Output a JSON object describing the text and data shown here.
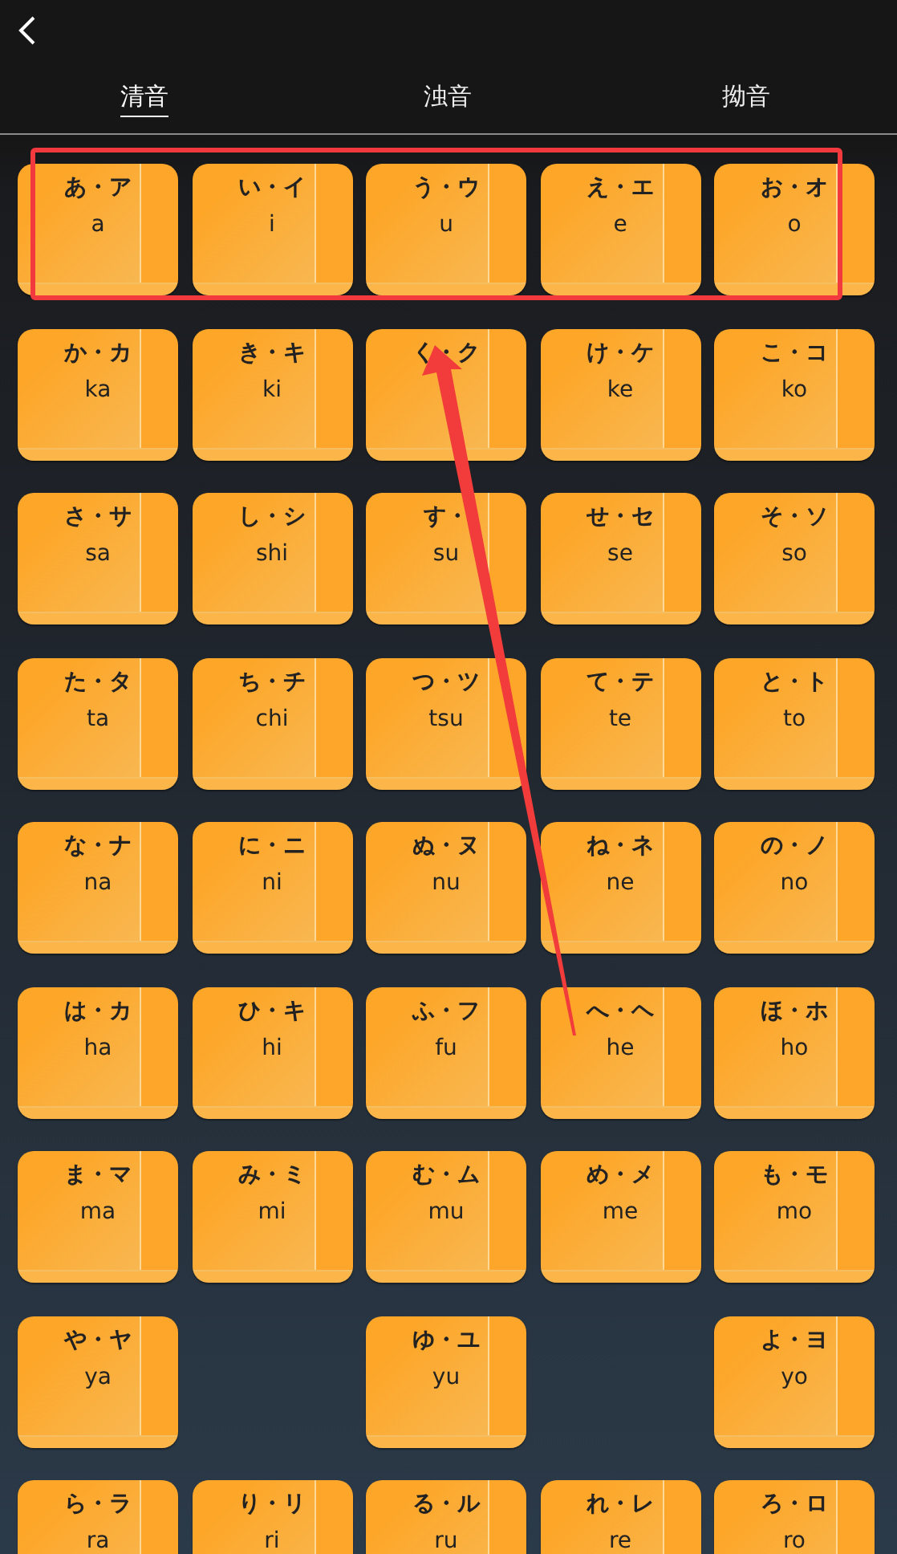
{
  "tabs": [
    {
      "label": "清音",
      "selected": true
    },
    {
      "label": "浊音",
      "selected": false
    },
    {
      "label": "拗音",
      "selected": false
    }
  ],
  "keys": [
    {
      "kind": "key",
      "kana": "あ・ア",
      "romaji": "a"
    },
    {
      "kind": "key",
      "kana": "い・イ",
      "romaji": "i"
    },
    {
      "kind": "key",
      "kana": "う・ウ",
      "romaji": "u"
    },
    {
      "kind": "key",
      "kana": "え・エ",
      "romaji": "e"
    },
    {
      "kind": "key",
      "kana": "お・オ",
      "romaji": "o"
    },
    {
      "kind": "key",
      "kana": "か・カ",
      "romaji": "ka"
    },
    {
      "kind": "key",
      "kana": "き・キ",
      "romaji": "ki"
    },
    {
      "kind": "key",
      "kana": "く・ク"
    },
    {
      "kind": "key",
      "kana": "け・ケ",
      "romaji": "ke"
    },
    {
      "kind": "key",
      "kana": "こ・コ",
      "romaji": "ko"
    },
    {
      "kind": "key",
      "kana": "さ・サ",
      "romaji": "sa"
    },
    {
      "kind": "key",
      "kana": "し・シ",
      "romaji": "shi"
    },
    {
      "kind": "key",
      "kana": "す・",
      "romaji": "su"
    },
    {
      "kind": "key",
      "kana": "せ・セ",
      "romaji": "se"
    },
    {
      "kind": "key",
      "kana": "そ・ソ",
      "romaji": "so"
    },
    {
      "kind": "key",
      "kana": "た・タ",
      "romaji": "ta"
    },
    {
      "kind": "key",
      "kana": "ち・チ",
      "romaji": "chi"
    },
    {
      "kind": "key",
      "kana": "つ・ツ",
      "romaji": "tsu"
    },
    {
      "kind": "key",
      "kana": "て・テ",
      "romaji": "te"
    },
    {
      "kind": "key",
      "kana": "と・ト",
      "romaji": "to"
    },
    {
      "kind": "key",
      "kana": "な・ナ",
      "romaji": "na"
    },
    {
      "kind": "key",
      "kana": "に・ニ",
      "romaji": "ni"
    },
    {
      "kind": "key",
      "kana": "ぬ・ヌ",
      "romaji": "nu"
    },
    {
      "kind": "key",
      "kana": "ね・ネ",
      "romaji": "ne"
    },
    {
      "kind": "key",
      "kana": "の・ノ",
      "romaji": "no"
    },
    {
      "kind": "key",
      "kana": "は・カ",
      "romaji": "ha"
    },
    {
      "kind": "key",
      "kana": "ひ・キ",
      "romaji": "hi"
    },
    {
      "kind": "key",
      "kana": "ふ・フ",
      "romaji": "fu"
    },
    {
      "kind": "key",
      "kana": "へ・ヘ",
      "romaji": "he"
    },
    {
      "kind": "key",
      "kana": "ほ・ホ",
      "romaji": "ho"
    },
    {
      "kind": "key",
      "kana": "ま・マ",
      "romaji": "ma"
    },
    {
      "kind": "key",
      "kana": "み・ミ",
      "romaji": "mi"
    },
    {
      "kind": "key",
      "kana": "む・ム",
      "romaji": "mu"
    },
    {
      "kind": "key",
      "kana": "め・メ",
      "romaji": "me"
    },
    {
      "kind": "key",
      "kana": "も・モ",
      "romaji": "mo"
    },
    {
      "kind": "key",
      "kana": "や・ヤ",
      "romaji": "ya"
    },
    {
      "kind": "blank"
    },
    {
      "kind": "key",
      "kana": "ゆ・ユ",
      "romaji": "yu"
    },
    {
      "kind": "blank"
    },
    {
      "kind": "key",
      "kana": "よ・ヨ",
      "romaji": "yo"
    },
    {
      "kind": "key",
      "kana": "ら・ラ",
      "romaji": "ra"
    },
    {
      "kind": "key",
      "kana": "り・リ",
      "romaji": "ri"
    },
    {
      "kind": "key",
      "kana": "る・ル",
      "romaji": "ru"
    },
    {
      "kind": "key",
      "kana": "れ・レ",
      "romaji": "re"
    },
    {
      "kind": "key",
      "kana": "ろ・ロ",
      "romaji": "ro"
    }
  ]
}
